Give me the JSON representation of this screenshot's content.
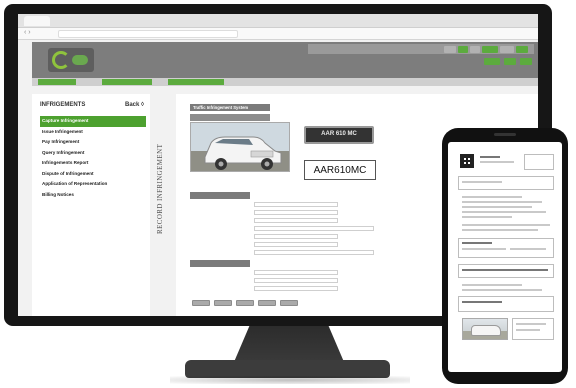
{
  "browser": {
    "tab_label": "",
    "url": ""
  },
  "header": {
    "app_title": "",
    "buttons": [
      "",
      "",
      "",
      "",
      "",
      "",
      "",
      ""
    ]
  },
  "menubar": {
    "items": [
      "",
      "",
      ""
    ]
  },
  "sidebar": {
    "title": "INFRIGEMENTS",
    "back_label": "Back",
    "items": [
      {
        "label": "Capture Infringement",
        "active": true
      },
      {
        "label": "Issue Infringement",
        "active": false
      },
      {
        "label": "Pay Infringement",
        "active": false
      },
      {
        "label": "Query Infringement",
        "active": false
      },
      {
        "label": "Infringements Report",
        "active": false
      },
      {
        "label": "Dispute of Infringement",
        "active": false
      },
      {
        "label": "Application of Representation",
        "active": false
      },
      {
        "label": "Billing Notices",
        "active": false
      }
    ]
  },
  "record_label": "RECORD INFRINGEMENT",
  "main": {
    "section_title": "Traffic Infringement System",
    "photo_section": "",
    "offence_section": "",
    "vehicle_section": "",
    "plate_photo_text": "AAR 610 MC",
    "plate_crop_text": "AAR610MC"
  },
  "colors": {
    "accent_green": "#4da12f",
    "header_grey": "#7d7d7d",
    "bezel": "#161616"
  },
  "icons": {
    "logo": "city-logo-icon",
    "qr": "qr-code-icon"
  }
}
